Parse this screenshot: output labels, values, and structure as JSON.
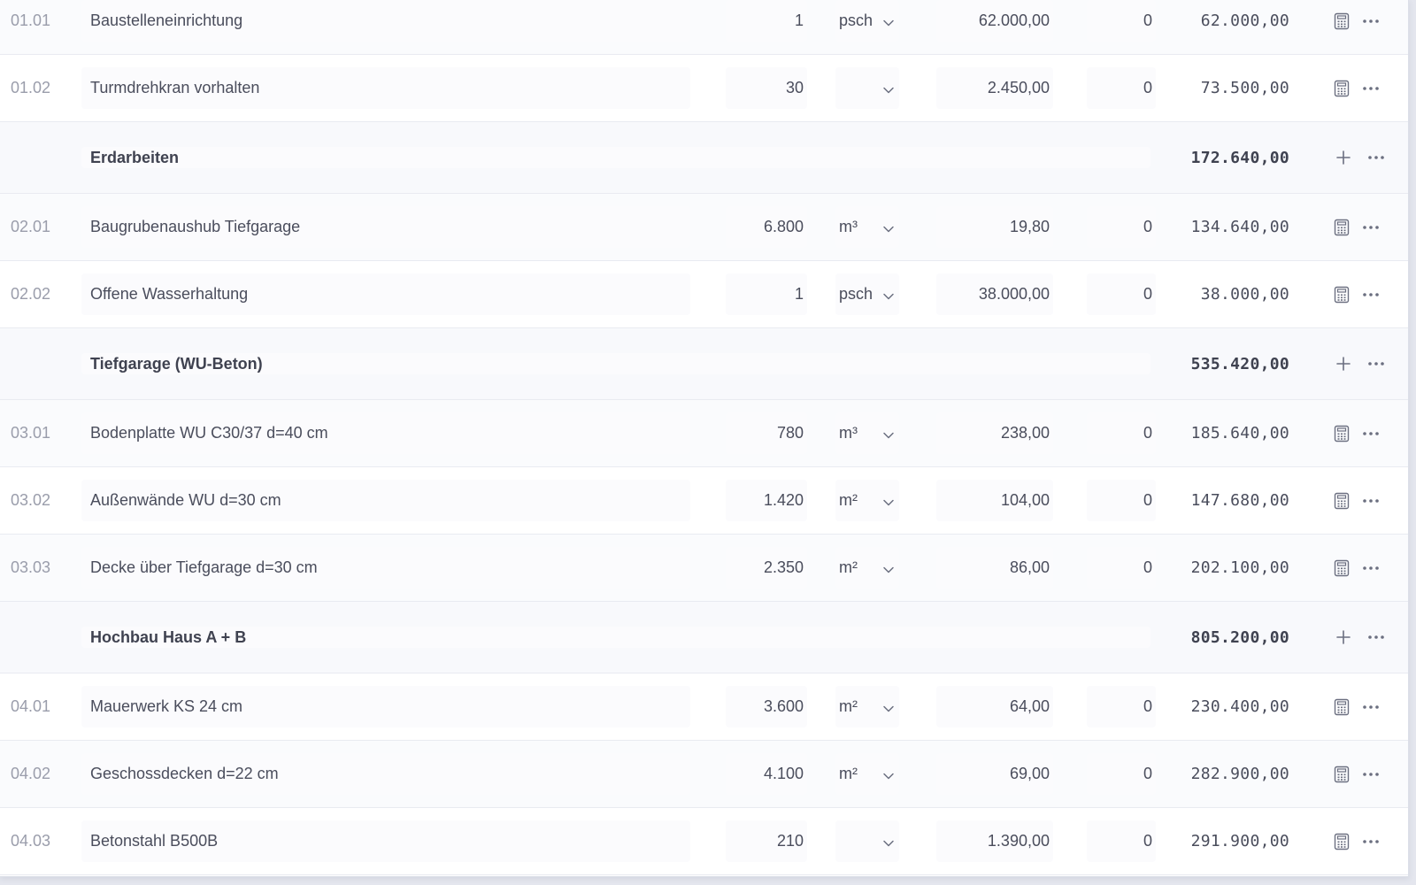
{
  "colors": {
    "panel_background": "#ffffff",
    "group_row_background": "#f8f9fc",
    "text": "#4a4d5c",
    "muted_text": "#9a9dab",
    "icon": "#6b6f80"
  },
  "rows": [
    {
      "kind": "item",
      "pos": "01.01",
      "description": "Baustelleneinrichtung",
      "quantity": "1",
      "unit": "psch",
      "unit_price": "62.000,00",
      "discount": "0",
      "total": "62.000,00"
    },
    {
      "kind": "item",
      "pos": "01.02",
      "description": "Turmdrehkran vorhalten",
      "quantity": "30",
      "unit": "",
      "unit_price": "2.450,00",
      "discount": "0",
      "total": "73.500,00"
    },
    {
      "kind": "group",
      "title": "Erdarbeiten",
      "total": "172.640,00"
    },
    {
      "kind": "item",
      "pos": "02.01",
      "description": "Baugrubenaushub Tiefgarage",
      "quantity": "6.800",
      "unit": "m³",
      "unit_price": "19,80",
      "discount": "0",
      "total": "134.640,00"
    },
    {
      "kind": "item",
      "pos": "02.02",
      "description": "Offene Wasserhaltung",
      "quantity": "1",
      "unit": "psch",
      "unit_price": "38.000,00",
      "discount": "0",
      "total": "38.000,00"
    },
    {
      "kind": "group",
      "title": "Tiefgarage (WU-Beton)",
      "total": "535.420,00"
    },
    {
      "kind": "item",
      "pos": "03.01",
      "description": "Bodenplatte WU C30/37 d=40 cm",
      "quantity": "780",
      "unit": "m³",
      "unit_price": "238,00",
      "discount": "0",
      "total": "185.640,00"
    },
    {
      "kind": "item",
      "pos": "03.02",
      "description": "Außenwände WU d=30 cm",
      "quantity": "1.420",
      "unit": "m²",
      "unit_price": "104,00",
      "discount": "0",
      "total": "147.680,00"
    },
    {
      "kind": "item",
      "pos": "03.03",
      "description": "Decke über Tiefgarage d=30 cm",
      "quantity": "2.350",
      "unit": "m²",
      "unit_price": "86,00",
      "discount": "0",
      "total": "202.100,00"
    },
    {
      "kind": "group",
      "title": "Hochbau Haus A + B",
      "total": "805.200,00"
    },
    {
      "kind": "item",
      "pos": "04.01",
      "description": "Mauerwerk KS 24 cm",
      "quantity": "3.600",
      "unit": "m²",
      "unit_price": "64,00",
      "discount": "0",
      "total": "230.400,00"
    },
    {
      "kind": "item",
      "pos": "04.02",
      "description": "Geschossdecken d=22 cm",
      "quantity": "4.100",
      "unit": "m²",
      "unit_price": "69,00",
      "discount": "0",
      "total": "282.900,00"
    },
    {
      "kind": "item",
      "pos": "04.03",
      "description": "Betonstahl B500B",
      "quantity": "210",
      "unit": "",
      "unit_price": "1.390,00",
      "discount": "0",
      "total": "291.900,00"
    }
  ]
}
